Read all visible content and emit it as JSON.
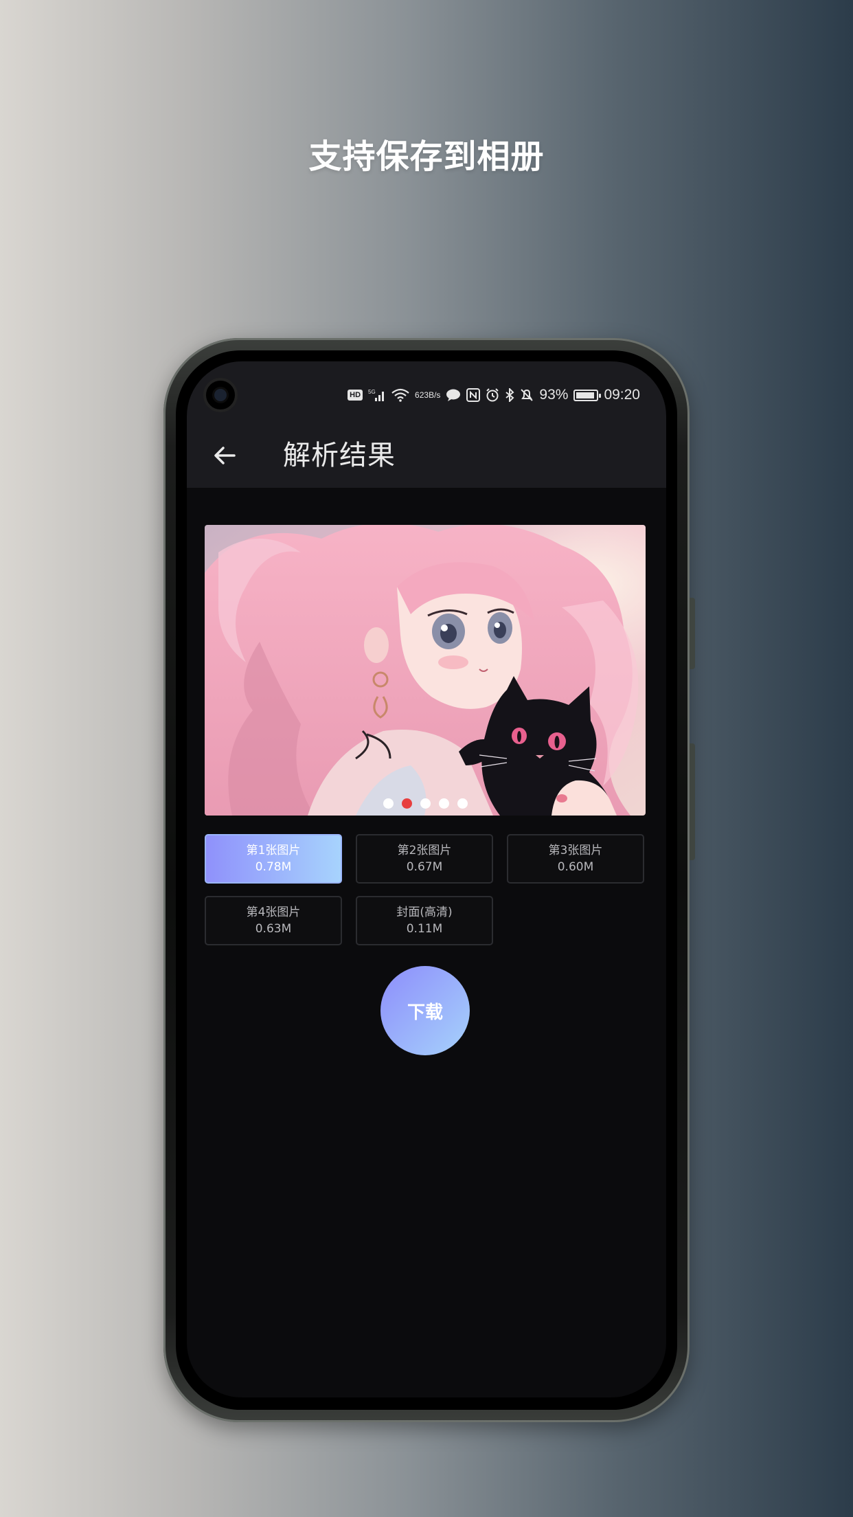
{
  "promo": {
    "title": "支持保存到相册"
  },
  "status_bar": {
    "hd": "HD",
    "net_speed_value": "623",
    "net_speed_unit": "B/s",
    "battery": "93%",
    "time": "09:20",
    "battery_level": 0.93,
    "icons": [
      "hd-icon",
      "signal-5g-icon",
      "wifi-icon",
      "chat-bubble-icon",
      "nfc-icon",
      "alarm-icon",
      "bluetooth-icon",
      "mute-bell-icon",
      "battery-icon"
    ]
  },
  "app_bar": {
    "title": "解析结果"
  },
  "carousel": {
    "count": 5,
    "active_index": 1
  },
  "options": [
    {
      "label": "第1张图片",
      "size": "0.78M",
      "selected": true
    },
    {
      "label": "第2张图片",
      "size": "0.67M",
      "selected": false
    },
    {
      "label": "第3张图片",
      "size": "0.60M",
      "selected": false
    },
    {
      "label": "第4张图片",
      "size": "0.63M",
      "selected": false
    },
    {
      "label": "封面(高清)",
      "size": "0.11M",
      "selected": false
    }
  ],
  "download": {
    "label": "下载"
  },
  "colors": {
    "accent_start": "#8f91fb",
    "accent_end": "#a7d3fd",
    "dot_active": "#e73e3e",
    "screen_bg": "#0b0b0d",
    "bar_bg": "#1b1b1f"
  }
}
